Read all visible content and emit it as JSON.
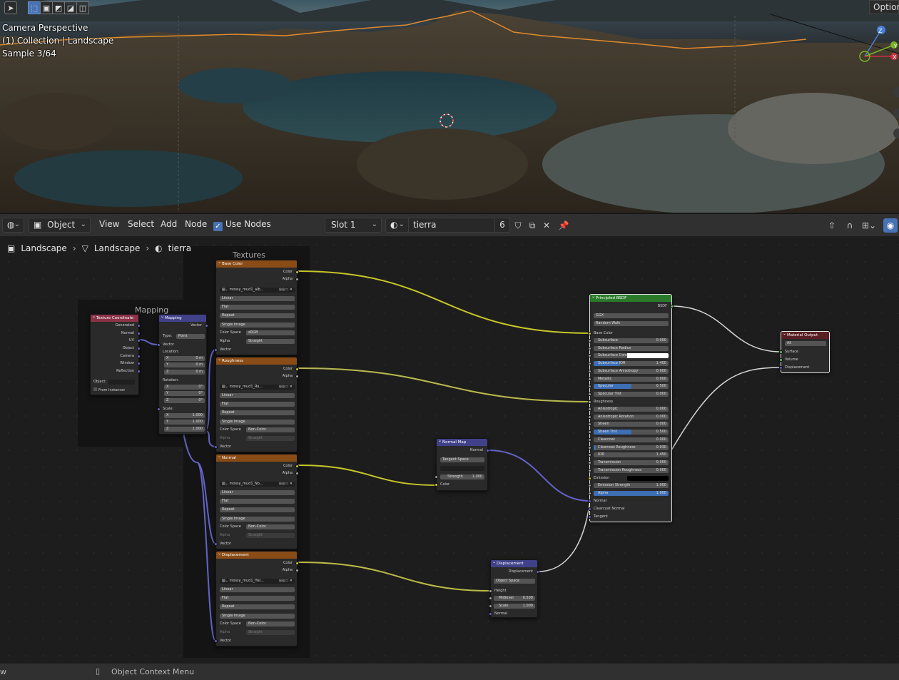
{
  "viewport": {
    "info_lines": [
      "Camera Perspective",
      "(1) Collection | Landscape",
      "Sample 3/64"
    ],
    "options_label": "Options"
  },
  "header": {
    "editor_type_icon": "shader-editor-icon",
    "mode": "Object",
    "menus": [
      "View",
      "Select",
      "Add",
      "Node"
    ],
    "use_nodes_label": "Use Nodes",
    "use_nodes_checked": true,
    "slot": "Slot 1",
    "material_name": "tierra",
    "user_count": "6"
  },
  "breadcrumb": [
    "Landscape",
    "Landscape",
    "tierra"
  ],
  "frames": {
    "textures": "Textures",
    "mapping": "Mapping"
  },
  "nodes": {
    "tex_coord": {
      "title": "Texture Coordinate",
      "outputs": [
        "Generated",
        "Normal",
        "UV",
        "Object",
        "Camera",
        "Window",
        "Reflection"
      ],
      "object_label": "Object:",
      "from_instancer": "From Instancer"
    },
    "mapping": {
      "title": "Mapping",
      "output": "Vector",
      "type_label": "Type:",
      "type_value": "Point",
      "vector": "Vector",
      "location_label": "Location:",
      "location": [
        {
          "axis": "X",
          "value": "0 m"
        },
        {
          "axis": "Y",
          "value": "0 m"
        },
        {
          "axis": "Z",
          "value": "0 m"
        }
      ],
      "rotation_label": "Rotation:",
      "rotation": [
        {
          "axis": "X",
          "value": "0°"
        },
        {
          "axis": "Y",
          "value": "0°"
        },
        {
          "axis": "Z",
          "value": "0°"
        }
      ],
      "scale_label": "Scale:",
      "scale": [
        {
          "axis": "X",
          "value": "1.000"
        },
        {
          "axis": "Y",
          "value": "1.000"
        },
        {
          "axis": "Z",
          "value": "1.000"
        }
      ]
    },
    "textures": [
      {
        "title": "Base Color",
        "image": "mossy_mud1_alb...",
        "interp": "Linear",
        "proj": "Flat",
        "ext": "Repeat",
        "source": "Single Image",
        "cs_label": "Color Space",
        "cs": "sRGB",
        "alpha_label": "Alpha",
        "alpha": "Straight"
      },
      {
        "title": "Roughness",
        "image": "mossy_mud1_Ro...",
        "interp": "Linear",
        "proj": "Flat",
        "ext": "Repeat",
        "source": "Single Image",
        "cs_label": "Color Space",
        "cs": "Non-Color",
        "alpha_label": "Alpha",
        "alpha": "Straight"
      },
      {
        "title": "Normal",
        "image": "mossy_mud1_No...",
        "interp": "Linear",
        "proj": "Flat",
        "ext": "Repeat",
        "source": "Single Image",
        "cs_label": "Color Space",
        "cs": "Non-Color",
        "alpha_label": "Alpha",
        "alpha": "Straight"
      },
      {
        "title": "Displacement",
        "image": "mossy_mud1_Hei...",
        "interp": "Linear",
        "proj": "Flat",
        "ext": "Repeat",
        "source": "Single Image",
        "cs_label": "Color Space",
        "cs": "Non-Color",
        "alpha_label": "Alpha",
        "alpha": "Straight"
      }
    ],
    "tex_sockets": {
      "color": "Color",
      "alpha": "Alpha",
      "vector": "Vector"
    },
    "normal_map": {
      "title": "Normal Map",
      "output": "Normal",
      "space": "Tangent Space",
      "strength_label": "Strength",
      "strength": "1.000",
      "color": "Color"
    },
    "displacement": {
      "title": "Displacement",
      "output": "Displacement",
      "space": "Object Space",
      "height": "Height",
      "midlevel_label": "Midlevel",
      "midlevel": "0.500",
      "scale_label": "Scale",
      "scale": "1.000",
      "normal": "Normal"
    },
    "bsdf": {
      "title": "Principled BSDF",
      "output": "BSDF",
      "distribution": "GGX",
      "subsurface_method": "Random Walk",
      "base_color": "Base Color",
      "params": [
        {
          "label": "Subsurface",
          "value": "0.000",
          "fill": 0
        },
        {
          "label": "Subsurface Radius",
          "value": "",
          "fill": 0,
          "dropdown": true
        },
        {
          "label": "Subsurface Color",
          "value": "",
          "fill": 0,
          "color": "#ffffff"
        },
        {
          "label": "Subsurface IOR",
          "value": "1.400",
          "fill": 0.35
        },
        {
          "label": "Subsurface Anisotropy",
          "value": "0.000",
          "fill": 0
        },
        {
          "label": "Metallic",
          "value": "0.000",
          "fill": 0
        },
        {
          "label": "Specular",
          "value": "0.500",
          "fill": 0.5
        },
        {
          "label": "Specular Tint",
          "value": "0.000",
          "fill": 0
        }
      ],
      "roughness": "Roughness",
      "params2": [
        {
          "label": "Anisotropic",
          "value": "0.000",
          "fill": 0
        },
        {
          "label": "Anisotropic Rotation",
          "value": "0.000",
          "fill": 0
        },
        {
          "label": "Sheen",
          "value": "0.000",
          "fill": 0
        },
        {
          "label": "Sheen Tint",
          "value": "0.500",
          "fill": 0.5
        },
        {
          "label": "Clearcoat",
          "value": "0.000",
          "fill": 0
        },
        {
          "label": "Clearcoat Roughness",
          "value": "0.030",
          "fill": 0.03
        },
        {
          "label": "IOR",
          "value": "1.450",
          "fill": 0
        },
        {
          "label": "Transmission",
          "value": "0.000",
          "fill": 0
        },
        {
          "label": "Transmission Roughness",
          "value": "0.000",
          "fill": 0
        }
      ],
      "emission": "Emission",
      "emission_color": "#000000",
      "params3": [
        {
          "label": "Emission Strength",
          "value": "1.000",
          "fill": 0
        },
        {
          "label": "Alpha",
          "value": "1.000",
          "fill": 1
        }
      ],
      "normal": "Normal",
      "clearcoat_normal": "Clearcoat Normal",
      "tangent": "Tangent"
    },
    "output": {
      "title": "Material Output",
      "target": "All",
      "inputs": [
        "Surface",
        "Volume",
        "Displacement"
      ]
    }
  },
  "statusbar": {
    "left": "w",
    "context_menu": "Object Context Menu"
  },
  "colors": {
    "accent": "#4772b3",
    "color_socket": "#c7c729",
    "vector_socket": "#6363c7",
    "float_socket": "#a1a1a1",
    "shader_socket": "#63c763"
  }
}
